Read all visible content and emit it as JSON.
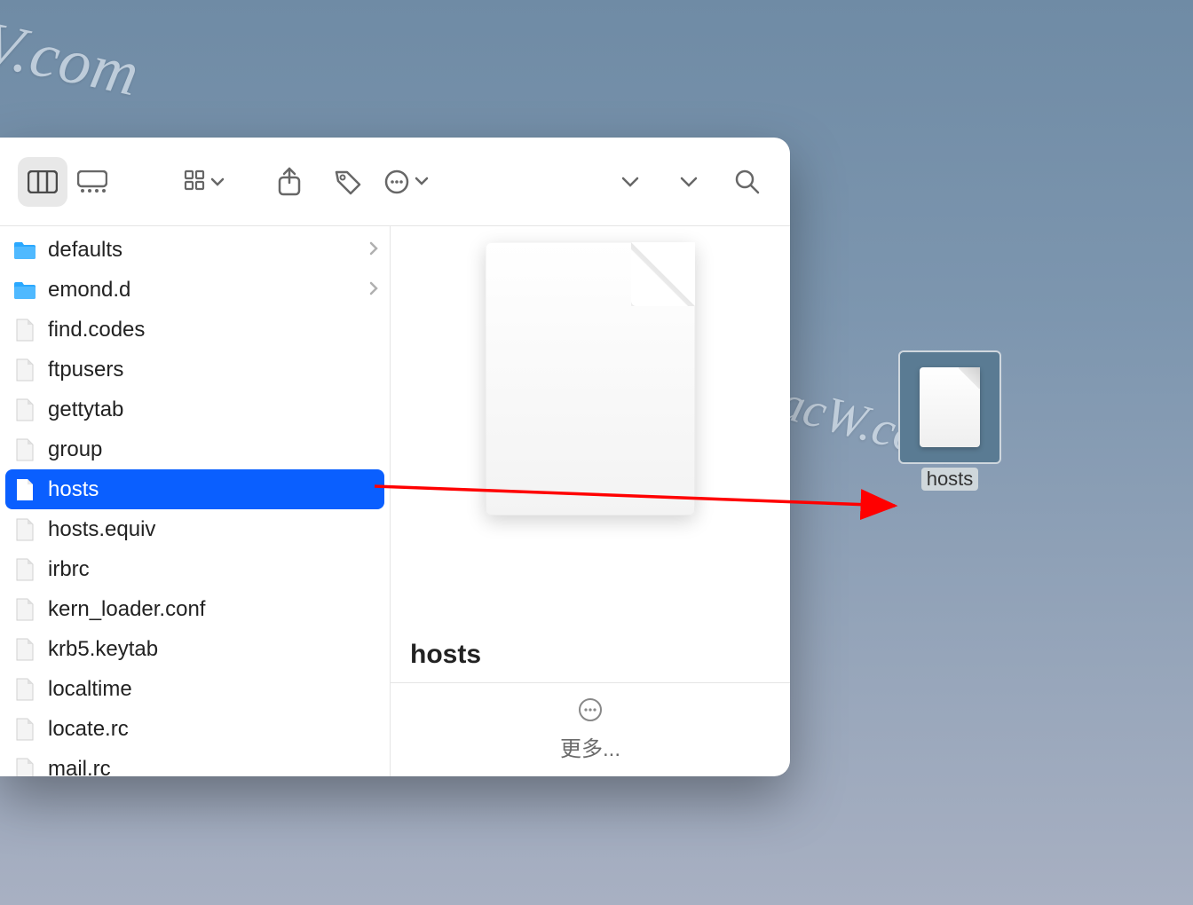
{
  "watermarks": {
    "wm1": "V.com",
    "wm2": "MacW.com"
  },
  "finder": {
    "items": [
      {
        "name": "defaults",
        "type": "folder",
        "hasChildren": true,
        "selected": false
      },
      {
        "name": "emond.d",
        "type": "folder",
        "hasChildren": true,
        "selected": false
      },
      {
        "name": "find.codes",
        "type": "file",
        "hasChildren": false,
        "selected": false
      },
      {
        "name": "ftpusers",
        "type": "file",
        "hasChildren": false,
        "selected": false
      },
      {
        "name": "gettytab",
        "type": "file",
        "hasChildren": false,
        "selected": false
      },
      {
        "name": "group",
        "type": "file",
        "hasChildren": false,
        "selected": false
      },
      {
        "name": "hosts",
        "type": "file",
        "hasChildren": false,
        "selected": true
      },
      {
        "name": "hosts.equiv",
        "type": "file",
        "hasChildren": false,
        "selected": false
      },
      {
        "name": "irbrc",
        "type": "file",
        "hasChildren": false,
        "selected": false
      },
      {
        "name": "kern_loader.conf",
        "type": "file",
        "hasChildren": false,
        "selected": false
      },
      {
        "name": "krb5.keytab",
        "type": "file",
        "hasChildren": false,
        "selected": false
      },
      {
        "name": "localtime",
        "type": "file",
        "hasChildren": false,
        "selected": false
      },
      {
        "name": "locate.rc",
        "type": "file",
        "hasChildren": false,
        "selected": false
      },
      {
        "name": "mail.rc",
        "type": "file",
        "hasChildren": false,
        "selected": false
      }
    ],
    "preview": {
      "filename": "hosts",
      "more_label": "更多..."
    }
  },
  "desktop": {
    "dragged_filename": "hosts"
  }
}
